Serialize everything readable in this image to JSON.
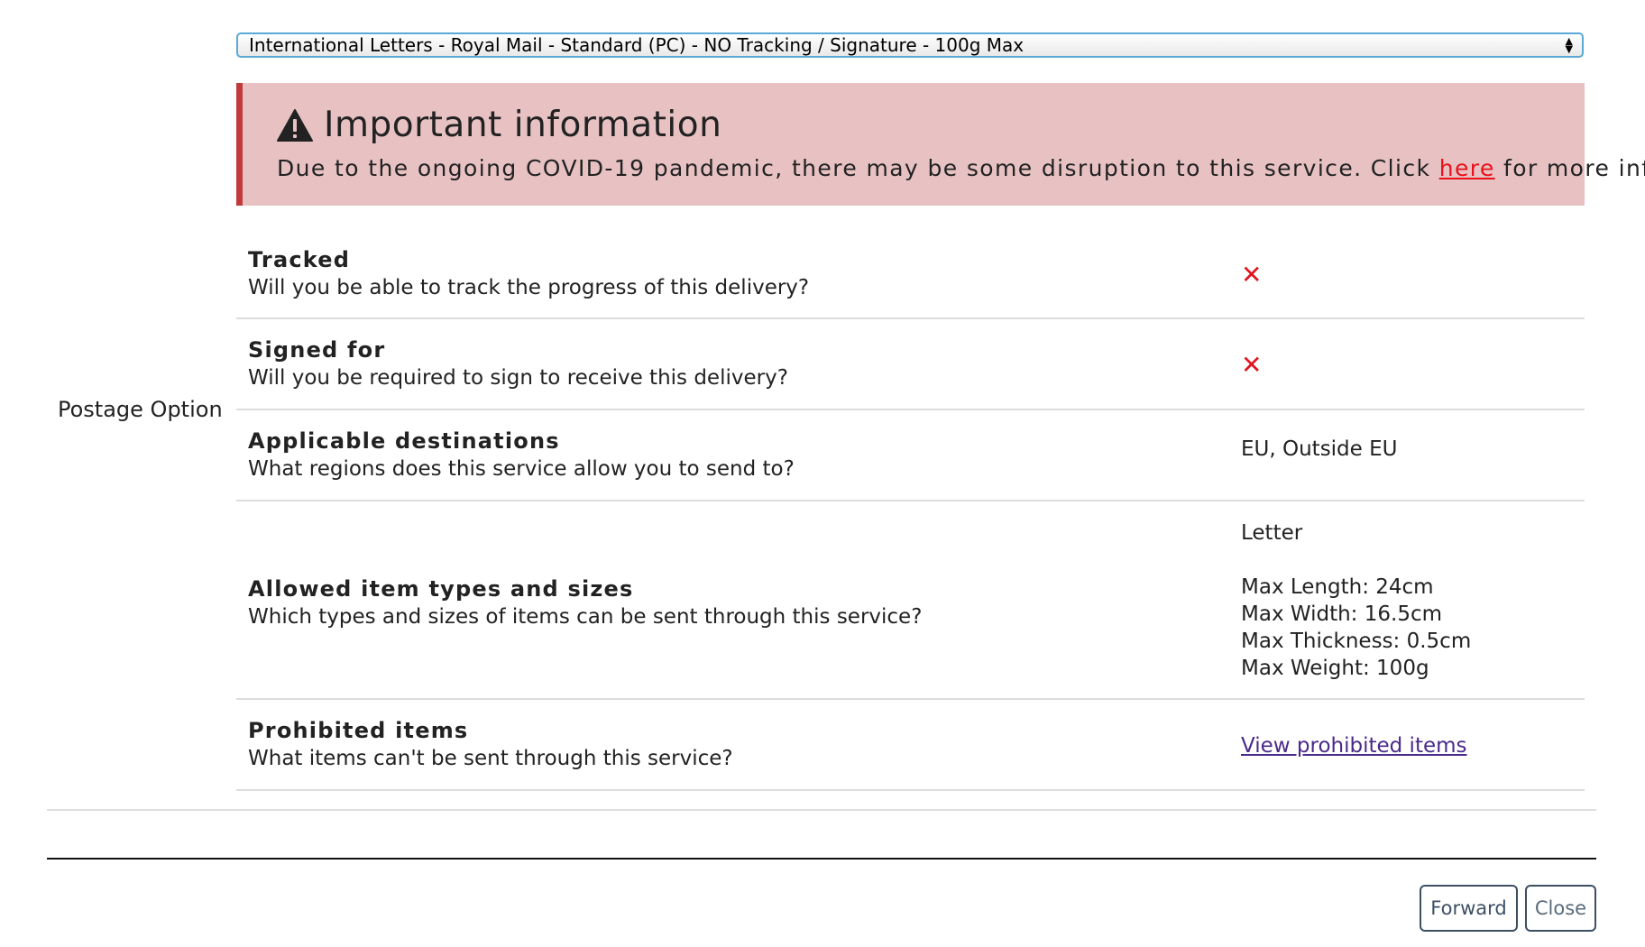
{
  "postage": {
    "row_label": "Postage Option",
    "selected_option": "International Letters - Royal Mail - Standard (PC) - NO Tracking / Signature - 100g Max"
  },
  "alert": {
    "icon": "warning-icon",
    "title": "Important information",
    "text_before": "Due to the ongoing COVID-19 pandemic, there may be some disruption to this service. Click ",
    "link_text": "here",
    "text_after": " for more info.",
    "colors": {
      "background": "#e8c2c3",
      "border": "#c0393b",
      "link": "#e8111b"
    }
  },
  "details": {
    "tracked": {
      "title": "Tracked",
      "description": "Will you be able to track the progress of this delivery?",
      "value_icon": "cross-icon",
      "value_glyph": "✕"
    },
    "signed_for": {
      "title": "Signed for",
      "description": "Will you be required to sign to receive this delivery?",
      "value_icon": "cross-icon",
      "value_glyph": "✕"
    },
    "destinations": {
      "title": "Applicable destinations",
      "description": "What regions does this service allow you to send to?",
      "value": "EU, Outside EU"
    },
    "item_types": {
      "title": "Allowed item types and sizes",
      "description": "Which types and sizes of items can be sent through this service?",
      "type": "Letter",
      "max_length": "Max Length: 24cm",
      "max_width": "Max Width: 16.5cm",
      "max_thickness": "Max Thickness: 0.5cm",
      "max_weight": "Max Weight: 100g"
    },
    "prohibited": {
      "title": "Prohibited items",
      "description": "What items can't be sent through this service?",
      "link_text": "View prohibited items"
    }
  },
  "buttons": {
    "forward": "Forward",
    "close": "Close"
  },
  "colors": {
    "cross": "#e0141e",
    "select_border": "#5aa9d6",
    "button": "#3c4f63"
  }
}
